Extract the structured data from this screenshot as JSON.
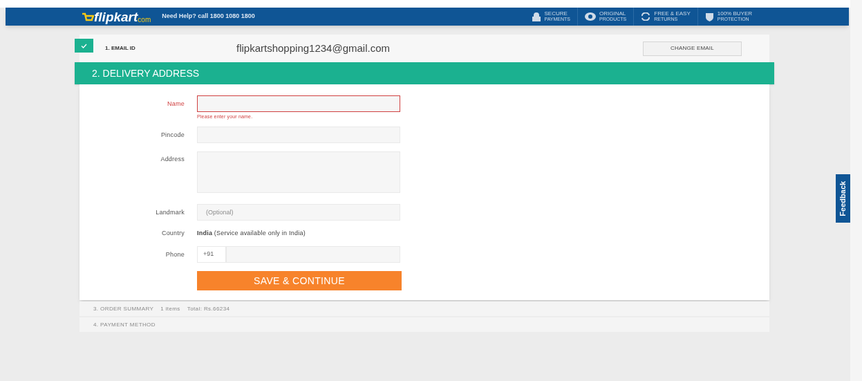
{
  "header": {
    "logo": "flipkart",
    "logo_suffix": "com",
    "help": "Need Help? call 1800 1080 1800",
    "badges": [
      {
        "kind": "lock",
        "line1": "SECURE",
        "line2": "PAYMENTS"
      },
      {
        "kind": "seal",
        "line1": "ORIGINAL",
        "line2": "PRODUCTS"
      },
      {
        "kind": "returns",
        "line1": "FREE & EASY",
        "line2": "RETURNS"
      },
      {
        "kind": "shield",
        "line1": "100% BUYER",
        "line2": "PROTECTION"
      }
    ]
  },
  "email_step": {
    "label": "1. EMAIL ID",
    "completed": true,
    "value": "flipkartshopping1234@gmail.com",
    "button": "CHANGE EMAIL"
  },
  "delivery_step": {
    "title": "2. DELIVERY ADDRESS",
    "fields": [
      {
        "kind": "input",
        "label": "Name",
        "error": true,
        "error_text": "Please enter your name."
      },
      {
        "kind": "input",
        "label": "Pincode",
        "error": false
      },
      {
        "kind": "textarea",
        "label": "Address",
        "error": false
      },
      {
        "kind": "input",
        "label": "Landmark",
        "error": false,
        "placeholder": "(Optional)"
      },
      {
        "kind": "static",
        "label": "Country",
        "value": "**India** (Service available only in India)"
      },
      {
        "kind": "phone",
        "label": "Phone",
        "prefix": "+91",
        "error": false
      }
    ],
    "button": "SAVE & CONTINUE"
  },
  "order_summary": {
    "label": "3. ORDER SUMMARY",
    "items": "1 items",
    "total": "Total: Rs.66234"
  },
  "payment_step": {
    "label": "4. PAYMENT METHOD"
  },
  "feedback": "Feedback"
}
